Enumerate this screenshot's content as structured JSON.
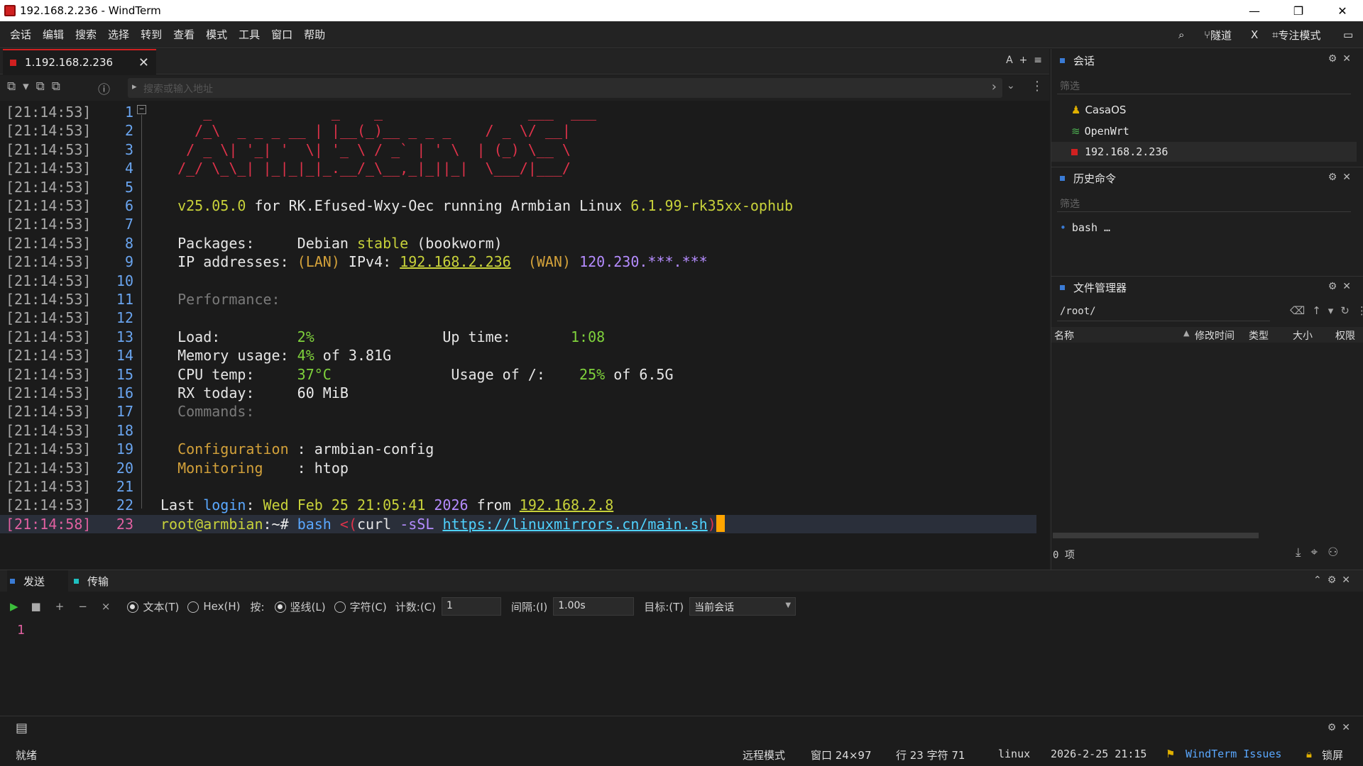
{
  "window": {
    "title": "192.168.2.236 - WindTerm",
    "minimize": "—",
    "restore": "❐",
    "close": "✕"
  },
  "menu": [
    "会话",
    "编辑",
    "搜索",
    "选择",
    "转到",
    "查看",
    "模式",
    "工具",
    "窗口",
    "帮助"
  ],
  "menu_right": {
    "tunnel": "隧道",
    "x": "X",
    "focus": "专注模式"
  },
  "tab": {
    "label": "1.192.168.2.236",
    "close": "✕",
    "right_controls": "A  +  ≡"
  },
  "address": {
    "placeholder": "搜索或输入地址"
  },
  "terminal": {
    "rows": [
      {
        "ts": "[21:14:53]",
        "ln": "1",
        "html": "<span class='red'>     _              _    _                 ___  ___ </span>"
      },
      {
        "ts": "[21:14:53]",
        "ln": "2",
        "html": "<span class='red'>    /_\\  _ _ _ __ | |__(_)__ _ _ _    / _ \\/ __|</span>"
      },
      {
        "ts": "[21:14:53]",
        "ln": "3",
        "html": "<span class='red'>   / _ \\| '_| '  \\| '_ \\ / _` | ' \\  | (_) \\__ \\</span>"
      },
      {
        "ts": "[21:14:53]",
        "ln": "4",
        "html": "<span class='red'>  /_/ \\_\\_| |_|_|_|_.__/_\\__,_|_||_|  \\___/|___/</span>"
      },
      {
        "ts": "[21:14:53]",
        "ln": "5",
        "html": ""
      },
      {
        "ts": "[21:14:53]",
        "ln": "6",
        "html": "  <span class='yel'>v25.05.0</span> for RK.Efused-Wxy-Oec running Armbian Linux <span class='yel'>6.1.99-rk35xx-ophub</span>"
      },
      {
        "ts": "[21:14:53]",
        "ln": "7",
        "html": ""
      },
      {
        "ts": "[21:14:53]",
        "ln": "8",
        "html": "  Packages:     Debian <span class='yel'>stable</span> (bookworm)"
      },
      {
        "ts": "[21:14:53]",
        "ln": "9",
        "html": "  IP addresses: <span class='org'>(LAN)</span> IPv4: <span class='yel ul'>192.168.2.236</span>  <span class='org'>(WAN)</span> <span class='pur'>120.230.***.***</span>"
      },
      {
        "ts": "[21:14:53]",
        "ln": "10",
        "html": ""
      },
      {
        "ts": "[21:14:53]",
        "ln": "11",
        "html": "  <span class='gry'>Performance:</span>"
      },
      {
        "ts": "[21:14:53]",
        "ln": "12",
        "html": ""
      },
      {
        "ts": "[21:14:53]",
        "ln": "13",
        "html": "  Load:         <span class='grn'>2%</span>               Up time:       <span class='grn'>1:08</span>"
      },
      {
        "ts": "[21:14:53]",
        "ln": "14",
        "html": "  Memory usage: <span class='grn'>4%</span> of 3.81G"
      },
      {
        "ts": "[21:14:53]",
        "ln": "15",
        "html": "  CPU temp:     <span class='grn'>37°C</span>              Usage of /:    <span class='grn'>25%</span> of 6.5G"
      },
      {
        "ts": "[21:14:53]",
        "ln": "16",
        "html": "  RX today:     <span class='wht'>60 MiB</span>"
      },
      {
        "ts": "[21:14:53]",
        "ln": "17",
        "html": "  <span class='gry'>Commands:</span>"
      },
      {
        "ts": "[21:14:53]",
        "ln": "18",
        "html": ""
      },
      {
        "ts": "[21:14:53]",
        "ln": "19",
        "html": "  <span class='org'>Configuration</span> : armbian-config"
      },
      {
        "ts": "[21:14:53]",
        "ln": "20",
        "html": "  <span class='org'>Monitoring</span>    : htop"
      },
      {
        "ts": "[21:14:53]",
        "ln": "21",
        "html": ""
      },
      {
        "ts": "[21:14:53]",
        "ln": "22",
        "html": "Last <span class='blu'>login</span>: <span class='yel'>Wed Feb 25 21:05:41</span> <span class='pur'>2026</span> from <span class='yel ul'>192.168.2.8</span>"
      },
      {
        "ts": "[21:14:58]",
        "ln": "23",
        "html": "<span class='yel'>root@armbian</span>:<span class='wht'>~#</span> <span class='blu'>bash</span> <span class='red'>&lt;(</span>curl <span class='pur'>-sSL</span> <span class='cya ul'>https://linuxmirrors.cn/main.sh</span><span class='red'>)</span>"
      }
    ]
  },
  "panels": {
    "sessions": {
      "title": "会话",
      "filter": "筛选",
      "items": [
        "CasaOS",
        "OpenWrt",
        "192.168.2.236"
      ]
    },
    "history": {
      "title": "历史命令",
      "filter": "筛选",
      "items": [
        "bash …"
      ]
    },
    "files": {
      "title": "文件管理器",
      "path": "/root/",
      "columns": [
        "名称",
        "修改时间",
        "类型",
        "大小",
        "权限"
      ],
      "count": "0 项"
    }
  },
  "bottom": {
    "tabs": [
      "发送",
      "传输"
    ],
    "opts": {
      "text": "文本(T)",
      "hex": "Hex(H)",
      "by": "按:",
      "vline": "竖线(L)",
      "char": "字符(C)",
      "count_label": "计数:(C)",
      "count": "1",
      "interval_label": "间隔:(I)",
      "interval": "1.00s",
      "target_label": "目标:(T)",
      "target": "当前会话"
    },
    "line": "1"
  },
  "status": {
    "ready": "就绪",
    "mode": "远程模式",
    "window": "窗口 24×97",
    "pos": "行 23 字符 71",
    "os": "linux",
    "datetime": "2026-2-25 21:15",
    "issues": "WindTerm Issues",
    "lock": "锁屏"
  },
  "colors": {
    "accent": "#d02020",
    "blue": "#3a7bd5"
  }
}
